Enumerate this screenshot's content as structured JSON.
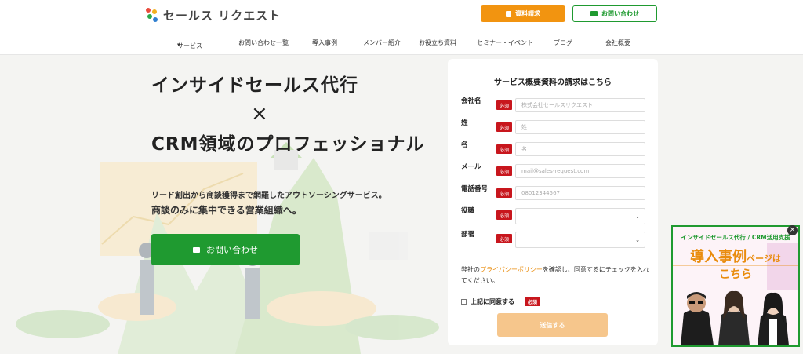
{
  "header": {
    "logo_text": "セールス リクエスト",
    "doc_button": "資料請求",
    "contact_button": "お問い合わせ",
    "nav": [
      "サービス",
      "お問い合わせ一覧",
      "導入事例",
      "メンバー紹介",
      "お役立ち資料",
      "セミナー・イベント",
      "ブログ",
      "会社概要"
    ],
    "nav_dropdown_icon": "chevron-down-icon"
  },
  "hero": {
    "title_line1": "インサイドセールス代行",
    "cross": "×",
    "title_line2": "CRM領域のプロフェッショナル",
    "sub1": "リード創出から商談獲得まで網羅したアウトソーシングサービス。",
    "sub2": "商談のみに集中できる営業組織へ。",
    "cta": "お問い合わせ"
  },
  "form": {
    "title": "サービス概要資料の請求はこちら",
    "required_badge": "必須",
    "fields": [
      {
        "label": "会社名",
        "placeholder": "株式会社セールスリクエスト"
      },
      {
        "label": "姓",
        "placeholder": "姓"
      },
      {
        "label": "名",
        "placeholder": "名"
      },
      {
        "label": "メール",
        "placeholder": "mail@sales-request.com"
      },
      {
        "label": "電話番号",
        "placeholder": "08012344567"
      },
      {
        "label": "役職",
        "placeholder": ""
      },
      {
        "label": "部署",
        "placeholder": ""
      }
    ],
    "consent_prefix": "弊社の",
    "consent_link": "プライバシーポリシー",
    "consent_suffix": "を確認し、同意するにチェックを入れてください。",
    "agree_label": "上記に同意する",
    "submit": "送信する"
  },
  "banner": {
    "top": "インサイドセールス代行 / CRM活用支援",
    "main": "導入事例",
    "main_suffix": "ページは",
    "sub": "こちら",
    "close": "×"
  },
  "colors": {
    "green": "#1f9a30",
    "orange": "#f29410",
    "required_red": "#c8161d",
    "submit_disabled": "#f6c68c"
  }
}
